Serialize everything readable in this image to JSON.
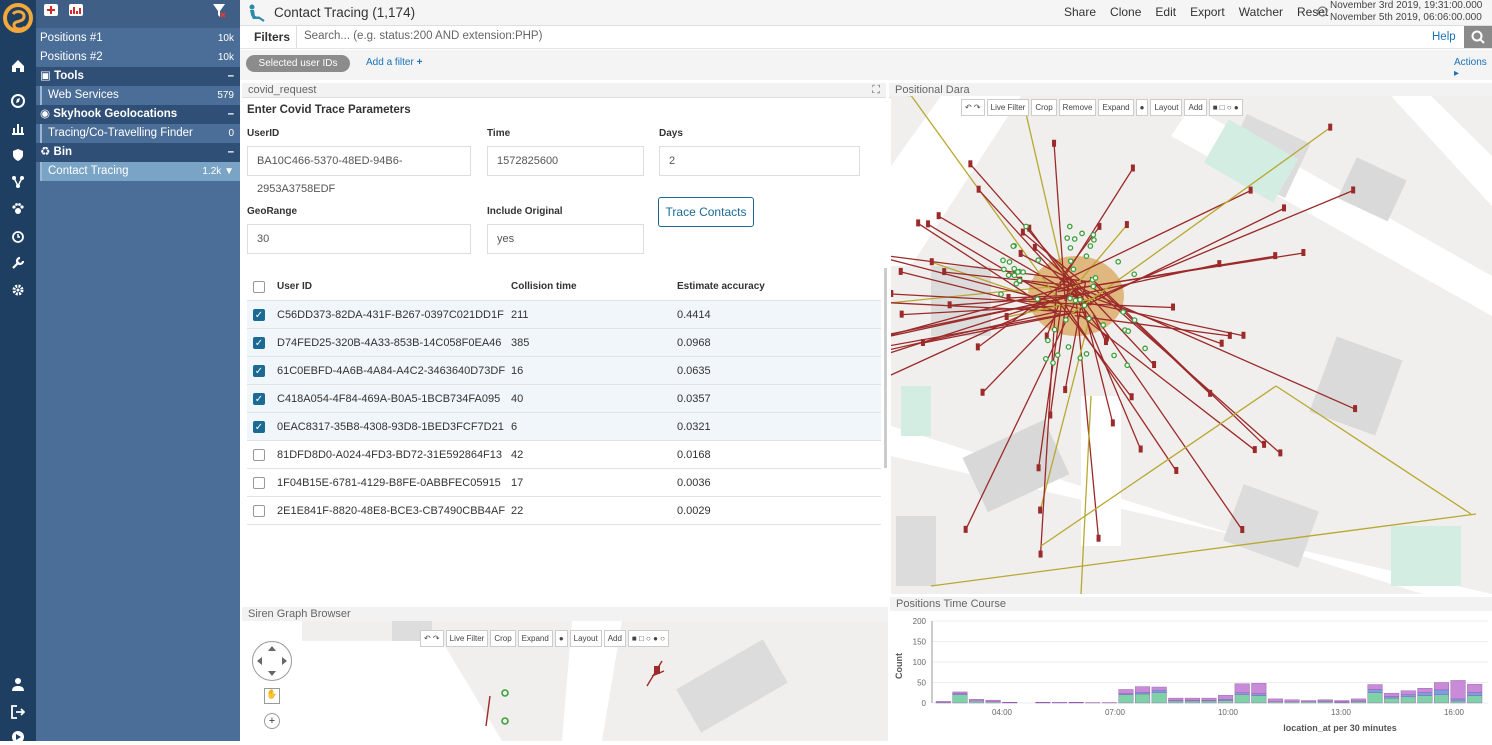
{
  "sidebar": {
    "items": [
      {
        "label": "Positions #1",
        "count": "10k"
      },
      {
        "label": "Positions #2",
        "count": "10k"
      }
    ],
    "groups": [
      {
        "label": "Tools",
        "items": [
          {
            "label": "Web Services",
            "count": "579"
          }
        ]
      },
      {
        "label": "Skyhook Geolocations",
        "items": [
          {
            "label": "Tracing/Co-Travelling Finder",
            "count": "0"
          }
        ]
      },
      {
        "label": "Bin",
        "items": [
          {
            "label": "Contact Tracing",
            "count": "1.2k"
          }
        ]
      }
    ]
  },
  "header": {
    "title": "Contact Tracing (1,174)",
    "menu": [
      "Share",
      "Clone",
      "Edit",
      "Export",
      "Watcher",
      "Reset"
    ],
    "date_from": "November 3rd 2019, 19:31:00.000",
    "date_to": "November 5th 2019, 06:06:00.000"
  },
  "filters": {
    "label": "Filters",
    "placeholder": "Search... (e.g. status:200 AND extension:PHP)",
    "help": "Help",
    "chip": "Selected user IDs",
    "add": "Add a filter",
    "actions": "Actions"
  },
  "panels": {
    "form": "covid_request",
    "map": "Positional Dara",
    "graph": "Siren Graph Browser",
    "hist": "Positions Time Course"
  },
  "form": {
    "heading": "Enter Covid Trace Parameters",
    "userid_label": "UserID",
    "userid": "BA10C466-5370-48ED-94B6-2953A3758EDF",
    "time_label": "Time",
    "time": "1572825600",
    "days_label": "Days",
    "days": "2",
    "geo_label": "GeoRange",
    "geo": "30",
    "orig_label": "Include Original",
    "orig": "yes",
    "button": "Trace Contacts"
  },
  "table": {
    "headers": [
      "User ID",
      "Collision time",
      "Estimate accuracy"
    ],
    "rows": [
      {
        "id": "C56DD373-82DA-431F-B267-0397C021DD1F",
        "time": "211",
        "acc": "0.4414",
        "checked": true
      },
      {
        "id": "D74FED25-320B-4A33-853B-14C058F0EA46",
        "time": "385",
        "acc": "0.0968",
        "checked": true
      },
      {
        "id": "61C0EBFD-4A6B-4A84-A4C2-3463640D73DF",
        "time": "16",
        "acc": "0.0635",
        "checked": true
      },
      {
        "id": "C418A054-4F84-469A-B0A5-1BCB734FA095",
        "time": "40",
        "acc": "0.0357",
        "checked": true
      },
      {
        "id": "0EAC8317-35B8-4308-93D8-1BED3FCF7D21",
        "time": "6",
        "acc": "0.0321",
        "checked": true
      },
      {
        "id": "81DFD8D0-A024-4FD3-BD72-31E592864F13",
        "time": "42",
        "acc": "0.0168",
        "checked": false
      },
      {
        "id": "1F04B15E-6781-4129-B8FE-0ABBFEC05915",
        "time": "17",
        "acc": "0.0036",
        "checked": false
      },
      {
        "id": "2E1E841F-8820-48E8-BCE3-CB7490CBB4AF",
        "time": "22",
        "acc": "0.0029",
        "checked": false
      }
    ]
  },
  "map_toolbar": [
    "Live Filter",
    "Crop",
    "Remove",
    "Expand",
    "Layout",
    "Add"
  ],
  "graph_toolbar": [
    "Live Filter",
    "Crop",
    "Expand",
    "Layout",
    "Add"
  ],
  "colors": {
    "arrow_red": "#9b2a2a",
    "arrow_olive": "#b8a830",
    "node_green": "#3ca03c",
    "accent": "#1a6a94"
  },
  "chart_data": {
    "type": "bar",
    "stacked": true,
    "ylabel": "Count",
    "xlabel": "location_at per 30 minutes",
    "ylim": [
      0,
      200
    ],
    "yticks": [
      0,
      50,
      100,
      150,
      200
    ],
    "xticks": [
      "04:00",
      "07:00",
      "10:00",
      "13:00",
      "16:00"
    ],
    "series": [
      {
        "color": "#7fd1a8",
        "values": [
          2,
          20,
          5,
          3,
          1,
          0,
          1,
          0,
          1,
          0,
          0,
          20,
          22,
          25,
          5,
          5,
          5,
          6,
          20,
          18,
          3,
          3,
          3,
          4,
          2,
          4,
          25,
          12,
          15,
          18,
          20,
          5,
          18
        ]
      },
      {
        "color": "#7d9fe0",
        "values": [
          0,
          3,
          0,
          0,
          0,
          0,
          0,
          0,
          0,
          0,
          0,
          3,
          4,
          6,
          2,
          2,
          2,
          3,
          5,
          5,
          0,
          0,
          0,
          1,
          1,
          1,
          8,
          4,
          5,
          8,
          12,
          5,
          8
        ]
      },
      {
        "color": "#c98ad8",
        "values": [
          2,
          4,
          4,
          4,
          1,
          0,
          1,
          2,
          1,
          1,
          1,
          10,
          14,
          8,
          5,
          5,
          5,
          10,
          22,
          25,
          7,
          5,
          3,
          3,
          3,
          5,
          12,
          8,
          10,
          10,
          18,
          45,
          20
        ]
      }
    ]
  }
}
